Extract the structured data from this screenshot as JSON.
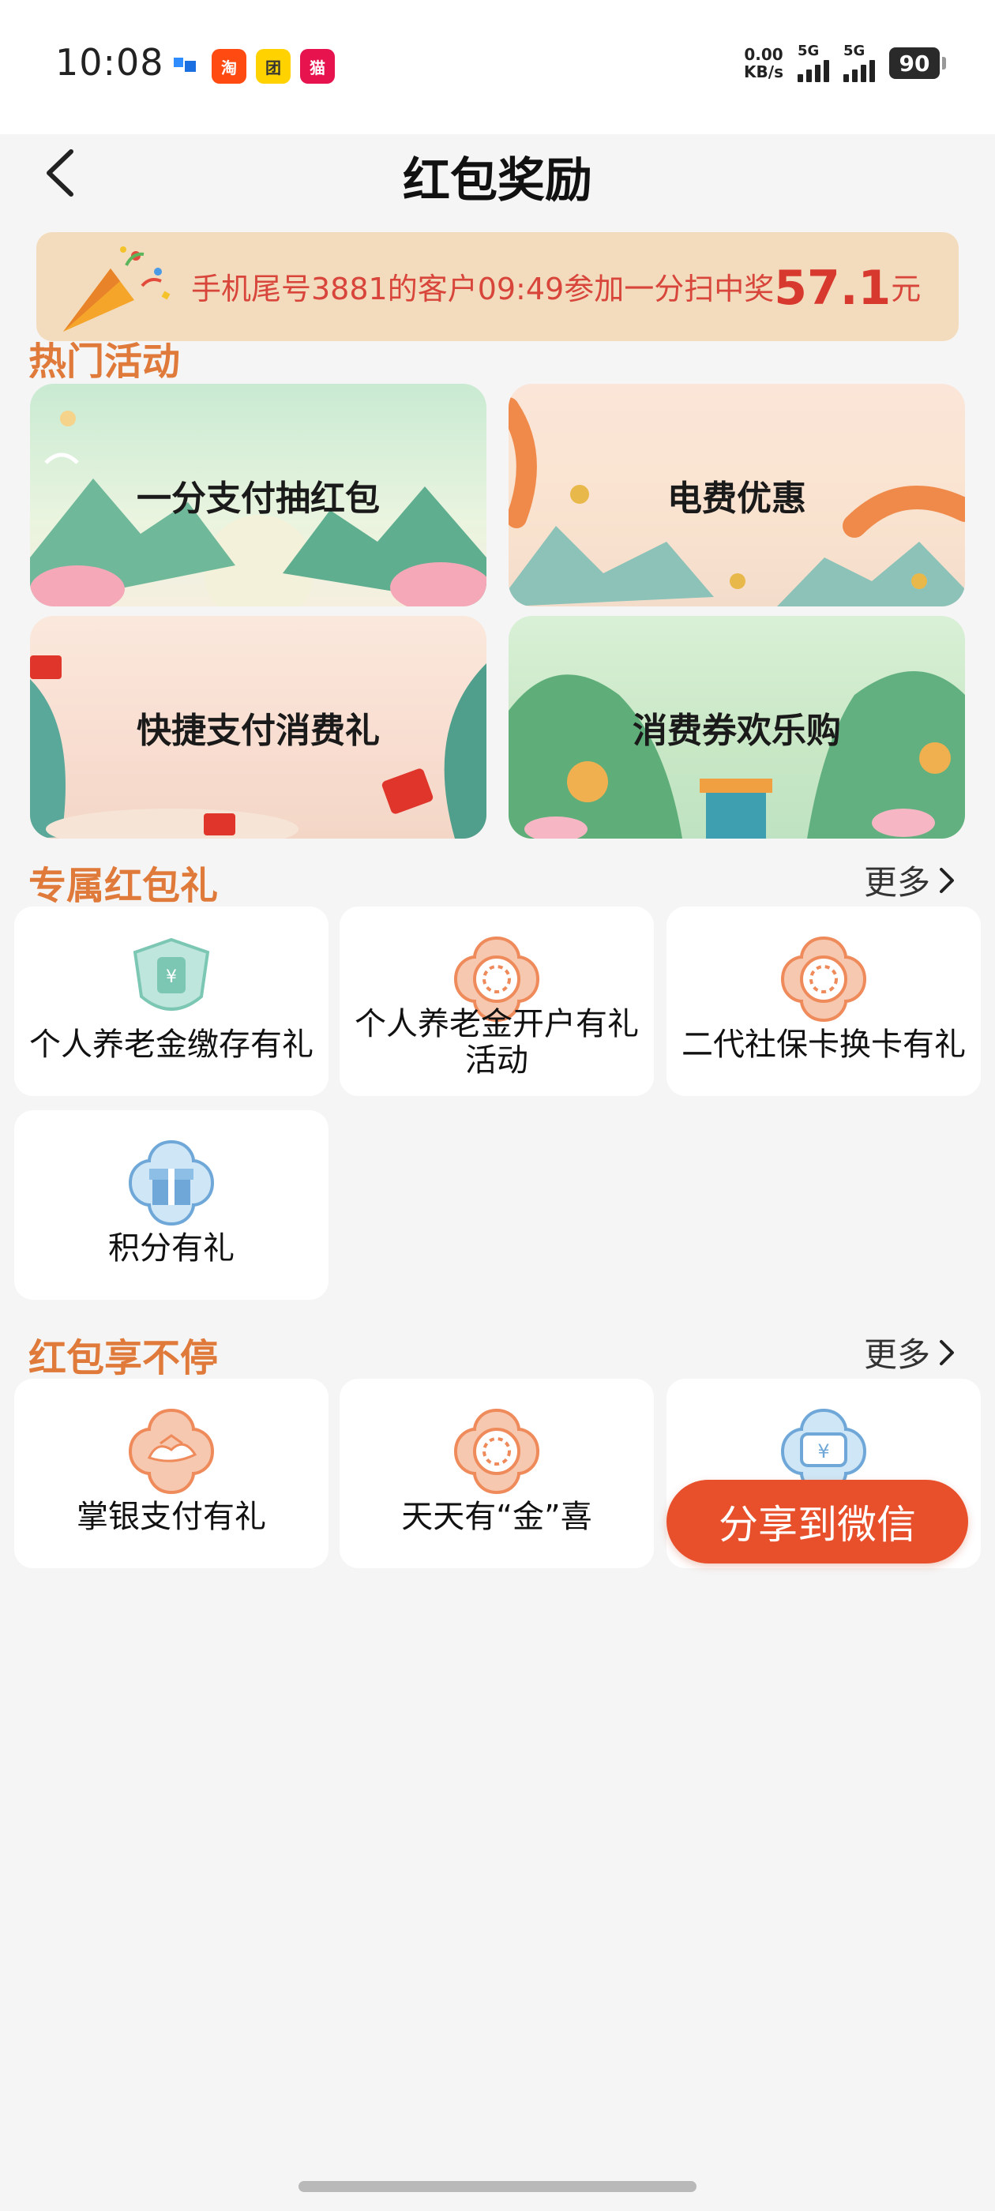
{
  "status_bar": {
    "time": "10:08",
    "apps": [
      {
        "icon": "dingtalk-icon",
        "color": "#2f8cff"
      },
      {
        "icon": "taobao-icon",
        "text": "淘",
        "color": "#ff4a12"
      },
      {
        "icon": "meituan-icon",
        "text": "团",
        "color": "#ffd200"
      },
      {
        "icon": "tmall-icon",
        "text": "猫",
        "color": "#e6134e"
      }
    ],
    "net_speed_value": "0.00",
    "net_speed_unit": "KB/s",
    "sim1_label": "5G",
    "sim2_label": "5G",
    "battery": "90"
  },
  "header": {
    "title": "红包奖励"
  },
  "ticker": {
    "text": "手机尾号3881的客户09:49参加一分扫中奖",
    "amount": "57.1",
    "unit": "元"
  },
  "hot": {
    "title": "热门活动",
    "cards": [
      {
        "label": "一分支付抽红包"
      },
      {
        "label": "电费优惠"
      },
      {
        "label": "快捷支付消费礼"
      },
      {
        "label": "消费券欢乐购"
      }
    ]
  },
  "exclusive": {
    "title": "专属红包礼",
    "more": "更多",
    "items": [
      {
        "label": "个人养老金缴存有礼",
        "icon": "pension-shield-icon"
      },
      {
        "label_line1": "个人养老金开户有礼",
        "label_line2": "活动",
        "icon": "coin-flower-icon"
      },
      {
        "label": "二代社保卡换卡有礼",
        "icon": "coin-flower-icon"
      },
      {
        "label": "积分有礼",
        "icon": "gift-box-icon"
      }
    ]
  },
  "nonstop": {
    "title": "红包享不停",
    "more": "更多",
    "items": [
      {
        "label": "掌银支付有礼",
        "icon": "cloud-flower-icon"
      },
      {
        "label": "天天有“金”喜",
        "icon": "coin-flower-icon"
      },
      {
        "label": "",
        "icon": "yuan-ticket-icon"
      }
    ]
  },
  "share_button": "分享到微信",
  "colors": {
    "accent_orange": "#e07a3a",
    "ticker_red": "#d8453b",
    "share_red": "#e8502c"
  }
}
